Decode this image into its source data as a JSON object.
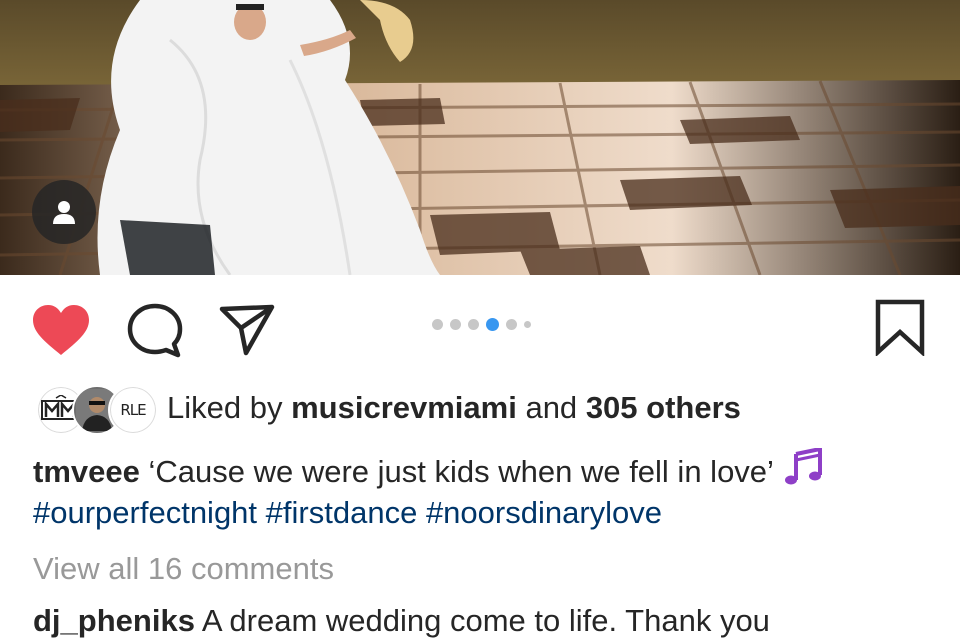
{
  "post": {
    "photo": {
      "icon": "user-tag-icon",
      "colors": {
        "grass": "#6b5a35",
        "floor_light": "#e8d3bd",
        "floor_dark": "#3a2618",
        "dress": "#f2f2f2"
      }
    },
    "actions": {
      "like_icon": "heart-filled-icon",
      "comment_icon": "comment-icon",
      "share_icon": "paper-plane-icon",
      "save_icon": "bookmark-icon",
      "like_color": "#ed4956",
      "carousel": {
        "count": 6,
        "active_index": 3,
        "active_color": "#3897f0"
      }
    },
    "likes": {
      "avatars": [
        {
          "label": "MRM",
          "icon": "musicrevmiami-logo-icon"
        },
        {
          "label": "",
          "icon": "person-photo-icon"
        },
        {
          "label": "RLE",
          "icon": "logo-icon"
        }
      ],
      "prefix": "Liked by",
      "first_liker": "musicrevmiami",
      "conjunction": "and",
      "others": "305 others"
    },
    "caption": {
      "username": "tmveee",
      "text": "‘Cause we were just kids when we fell in love’",
      "emoji_icon": "musical-notes-emoji-icon",
      "hashtags": [
        "#ourperfectnight",
        "#firstdance",
        "#noorsdinarylove"
      ]
    },
    "view_comments": "View all 16 comments",
    "comments": [
      {
        "username": "dj_pheniks",
        "text": "A dream wedding come to life. Thank you"
      }
    ],
    "colors": {
      "text": "#262626",
      "hashtag": "#003569",
      "muted": "#999999"
    }
  }
}
